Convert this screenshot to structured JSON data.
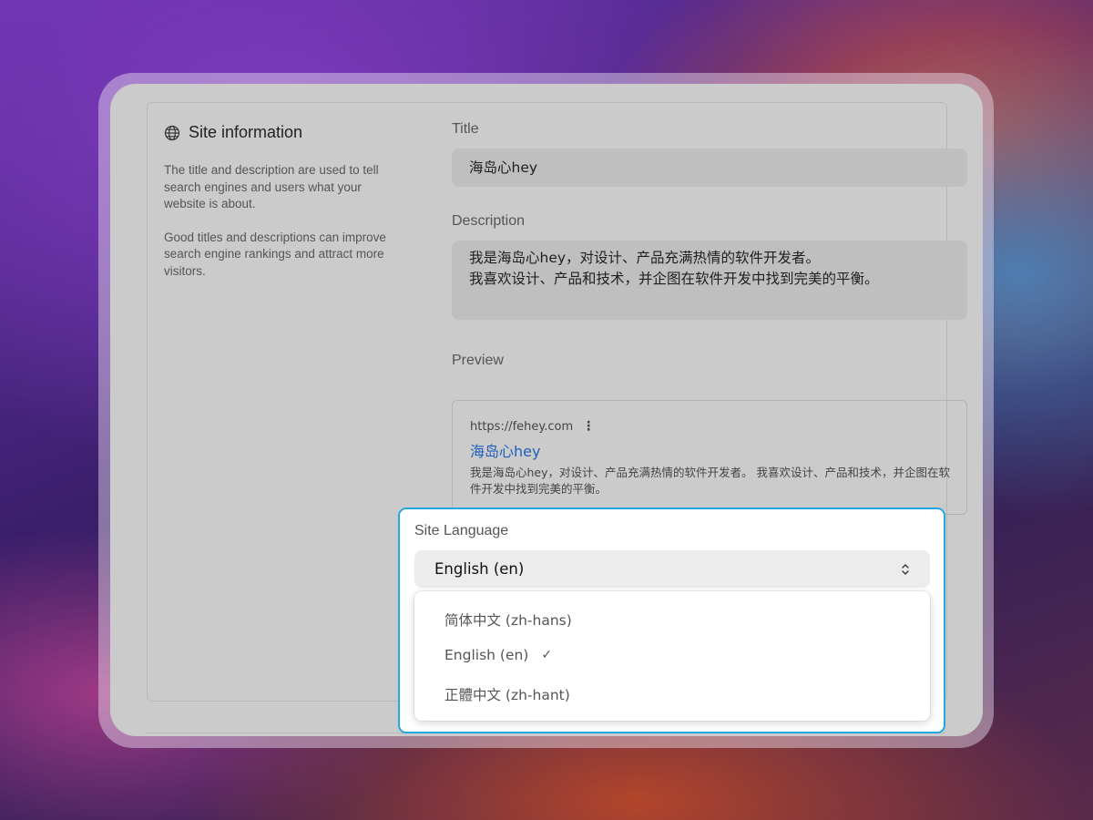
{
  "site_info": {
    "title": "Site information",
    "icon": "globe-icon",
    "description_1": "The title and description are used to tell search engines and users what your website is about.",
    "description_2": "Good titles and descriptions can improve search engine rankings and attract more visitors."
  },
  "form": {
    "title_label": "Title",
    "title_value": "海岛心hey",
    "description_label": "Description",
    "description_line1": "我是海岛心hey，对设计、产品充满热情的软件开发者。",
    "description_line2": "我喜欢设计、产品和技术，并企图在软件开发中找到完美的平衡。",
    "preview_label": "Preview"
  },
  "preview": {
    "url": "https://fehey.com",
    "title": "海岛心hey",
    "description": "我是海岛心hey，对设计、产品充满热情的软件开发者。 我喜欢设计、产品和技术，并企图在软件开发中找到完美的平衡。"
  },
  "language": {
    "label": "Site Language",
    "selected": "English (en)",
    "options": [
      {
        "label": "简体中文 (zh-hans)",
        "checked": false
      },
      {
        "label": "English (en)",
        "checked": true
      },
      {
        "label": "正體中文 (zh-hant)",
        "checked": false
      }
    ],
    "check_mark": "✓"
  },
  "colors": {
    "highlight_border": "#27a7e0",
    "link": "#1f5fbf"
  }
}
